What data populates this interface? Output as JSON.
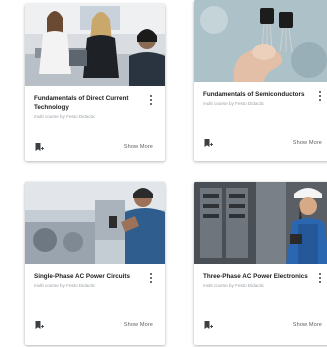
{
  "cards": [
    {
      "title": "Fundamentals of Direct Current Technology",
      "subtitle": "multi course by Festo Didactic",
      "menu_icon": "more-vert-icon",
      "bookmark_icon": "bookmark-add-icon",
      "action_label": "Show More"
    },
    {
      "title": "Fundamentals of Semiconductors",
      "subtitle": "multi course by Festo Didactic",
      "menu_icon": "more-vert-icon",
      "bookmark_icon": "bookmark-add-icon",
      "action_label": "Show More"
    },
    {
      "title": "Single-Phase AC Power Circuits",
      "subtitle": "multi course by Festo Didactic",
      "menu_icon": "more-vert-icon",
      "bookmark_icon": "bookmark-add-icon",
      "action_label": "Show More"
    },
    {
      "title": "Three-Phase AC Power Electronics",
      "subtitle": "multi course by Festo Didactic",
      "menu_icon": "more-vert-icon",
      "bookmark_icon": "bookmark-add-icon",
      "action_label": "Show More"
    }
  ]
}
